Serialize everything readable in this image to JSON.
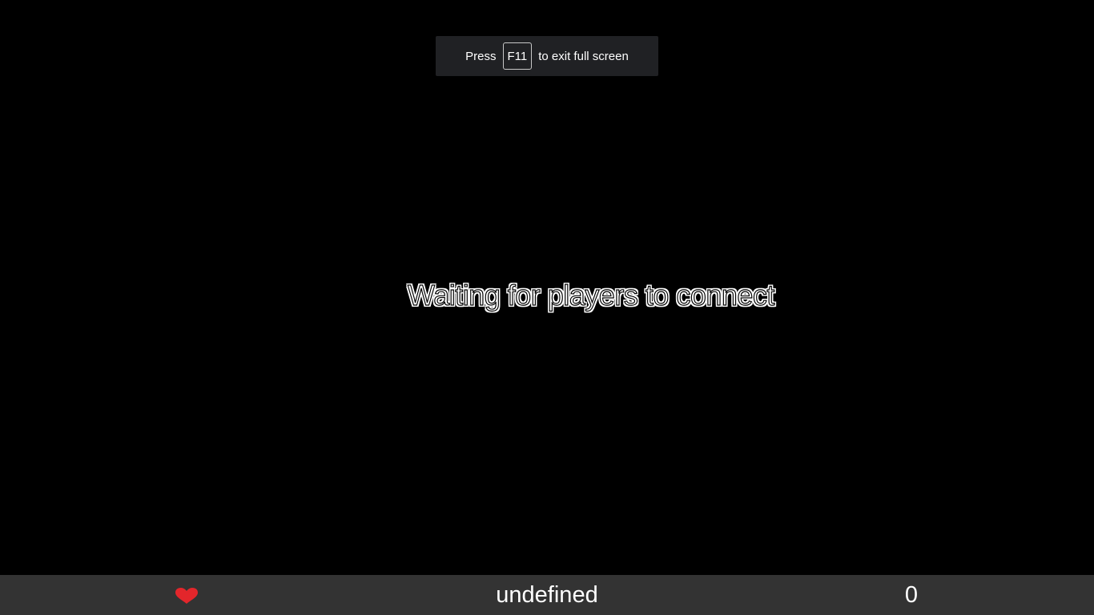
{
  "fullscreen_notice": {
    "prefix": "Press",
    "key": "F11",
    "suffix": "to exit full screen"
  },
  "status_message": "Waiting for players to connect",
  "hud": {
    "lives_icon": "heart-icon",
    "player_name": "undefined",
    "score": "0"
  },
  "colors": {
    "background": "#000000",
    "hud_bar": "#333333",
    "heart": "#e3262b",
    "toast": "#202124"
  }
}
